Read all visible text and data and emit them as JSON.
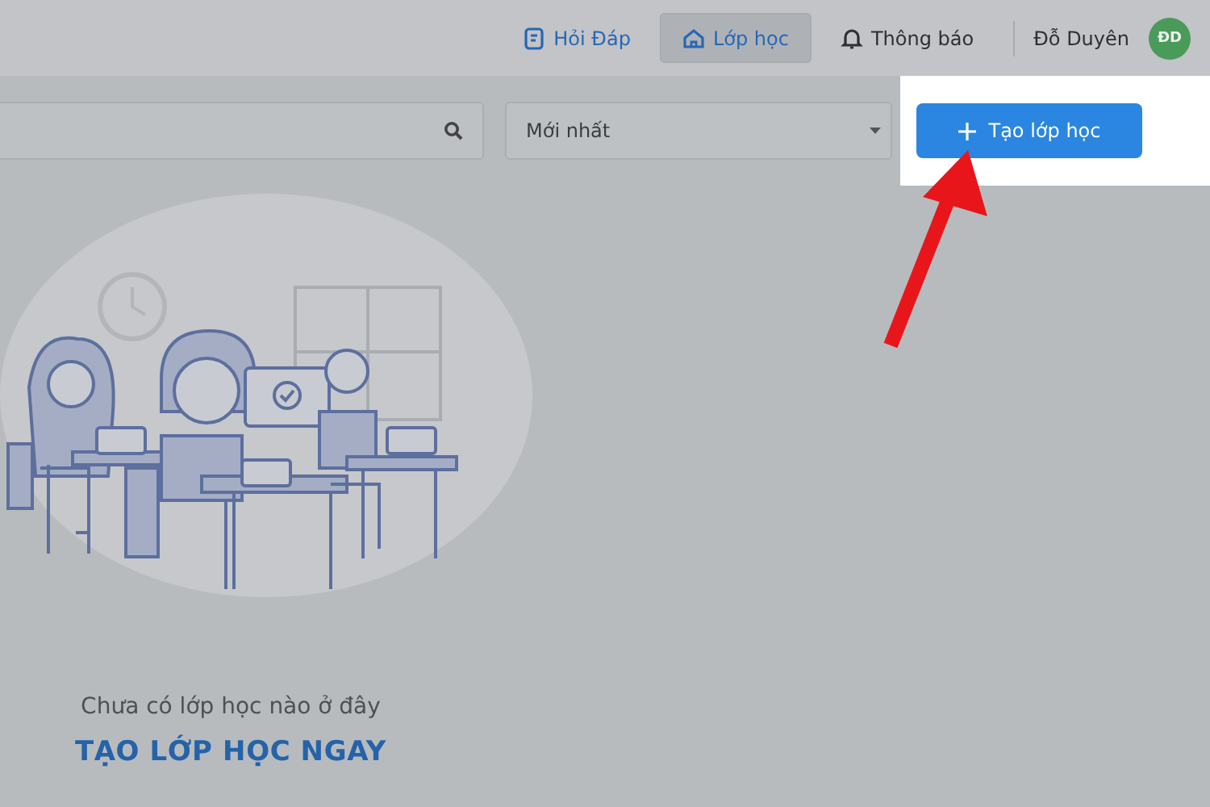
{
  "nav": {
    "items": [
      {
        "kind": "faq",
        "label": "Hỏi Đáp",
        "selected": false,
        "accent": true
      },
      {
        "kind": "classes",
        "label": "Lớp học",
        "selected": true,
        "accent": true
      },
      {
        "kind": "notifications",
        "label": "Thông báo",
        "selected": false,
        "accent": false
      }
    ],
    "user": {
      "name": "Đỗ Duyên",
      "initials": "ĐD"
    }
  },
  "toolbar": {
    "sort": {
      "value": "Mới nhất"
    },
    "create_button": "Tạo lớp học"
  },
  "empty_state": {
    "message": "Chưa có lớp học nào ở đây",
    "action": "TẠO LỚP HỌC NGAY"
  }
}
